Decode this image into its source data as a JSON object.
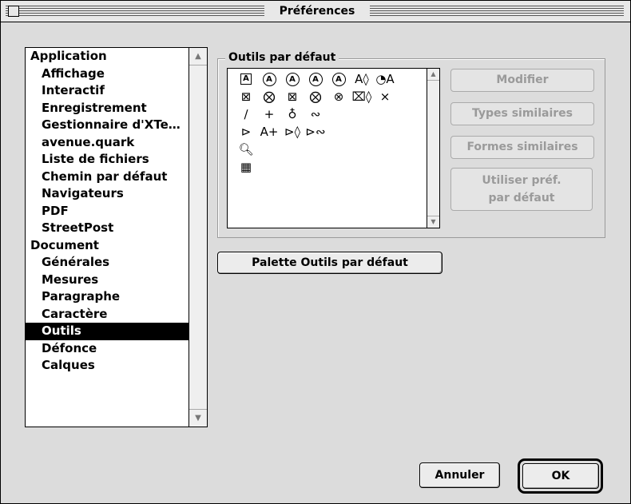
{
  "window": {
    "title": "Préférences"
  },
  "sidebar": {
    "items": [
      {
        "label": "Application",
        "level": 0,
        "selected": false
      },
      {
        "label": "Affichage",
        "level": 1,
        "selected": false
      },
      {
        "label": "Interactif",
        "level": 1,
        "selected": false
      },
      {
        "label": "Enregistrement",
        "level": 1,
        "selected": false
      },
      {
        "label": "Gestionnaire d'XTe…",
        "level": 1,
        "selected": false
      },
      {
        "label": "avenue.quark",
        "level": 1,
        "selected": false
      },
      {
        "label": "Liste de fichiers",
        "level": 1,
        "selected": false
      },
      {
        "label": "Chemin par défaut",
        "level": 1,
        "selected": false
      },
      {
        "label": "Navigateurs",
        "level": 1,
        "selected": false
      },
      {
        "label": "PDF",
        "level": 1,
        "selected": false
      },
      {
        "label": "StreetPost",
        "level": 1,
        "selected": false
      },
      {
        "label": "Document",
        "level": 0,
        "selected": false
      },
      {
        "label": "Générales",
        "level": 1,
        "selected": false
      },
      {
        "label": "Mesures",
        "level": 1,
        "selected": false
      },
      {
        "label": "Paragraphe",
        "level": 1,
        "selected": false
      },
      {
        "label": "Caractère",
        "level": 1,
        "selected": false
      },
      {
        "label": "Outils",
        "level": 1,
        "selected": true
      },
      {
        "label": "Défonce",
        "level": 1,
        "selected": false
      },
      {
        "label": "Calques",
        "level": 1,
        "selected": false
      }
    ]
  },
  "tools_group": {
    "label": "Outils par défaut",
    "tools": [
      {
        "icon": "rect-text-box-icon",
        "glyph": "A",
        "style": "framed"
      },
      {
        "icon": "rounded-text-box-icon",
        "glyph": "A",
        "style": "circ"
      },
      {
        "icon": "concave-text-box-icon",
        "glyph": "A",
        "style": "circ"
      },
      {
        "icon": "oval-text-box-icon",
        "glyph": "A",
        "style": "circ"
      },
      {
        "icon": "bezier-text-box-icon",
        "glyph": "A",
        "style": "circ"
      },
      {
        "icon": "freehand-text-box-icon",
        "glyph": "A◊",
        "style": "plain"
      },
      {
        "icon": "freehand-bezier-text-box-icon",
        "glyph": "◔A",
        "style": "plain"
      },
      {
        "icon": "rect-picture-box-icon",
        "glyph": "⊠",
        "style": "plain"
      },
      {
        "icon": "rounded-picture-box-icon",
        "glyph": "⨂",
        "style": "plain"
      },
      {
        "icon": "concave-picture-box-icon",
        "glyph": "⊠",
        "style": "plain"
      },
      {
        "icon": "oval-picture-box-icon",
        "glyph": "⨂",
        "style": "plain"
      },
      {
        "icon": "bezier-picture-box-icon",
        "glyph": "⊗",
        "style": "plain"
      },
      {
        "icon": "freehand-picture-box-icon",
        "glyph": "⌧◊",
        "style": "plain"
      },
      {
        "icon": "freehand-bezier-picture-box-icon",
        "glyph": "⨯",
        "style": "plain"
      },
      {
        "icon": "line-tool-icon",
        "glyph": "∕",
        "style": "plain"
      },
      {
        "icon": "orthogonal-line-icon",
        "glyph": "+",
        "style": "plain"
      },
      {
        "icon": "bezier-line-icon",
        "glyph": "♁",
        "style": "plain"
      },
      {
        "icon": "freehand-line-icon",
        "glyph": "∾",
        "style": "plain"
      },
      {
        "icon": "line-text-path-icon",
        "glyph": "⊳",
        "style": "plain"
      },
      {
        "icon": "orthogonal-text-path-icon",
        "glyph": "A+",
        "style": "plain"
      },
      {
        "icon": "bezier-text-path-icon",
        "glyph": "⊳◊",
        "style": "plain"
      },
      {
        "icon": "freehand-text-path-icon",
        "glyph": "⊳∾",
        "style": "plain"
      },
      {
        "icon": "zoom-tool-icon",
        "glyph": "🔍︎",
        "style": "plain"
      },
      {
        "icon": "table-tool-icon",
        "glyph": "▦",
        "style": "plain"
      }
    ]
  },
  "buttons": {
    "modifier": "Modifier",
    "types_similaires": "Types similaires",
    "formes_similaires": "Formes similaires",
    "utiliser_line1": "Utiliser préf.",
    "utiliser_line2": "par défaut",
    "palette": "Palette Outils par défaut",
    "annuler": "Annuler",
    "ok": "OK"
  }
}
